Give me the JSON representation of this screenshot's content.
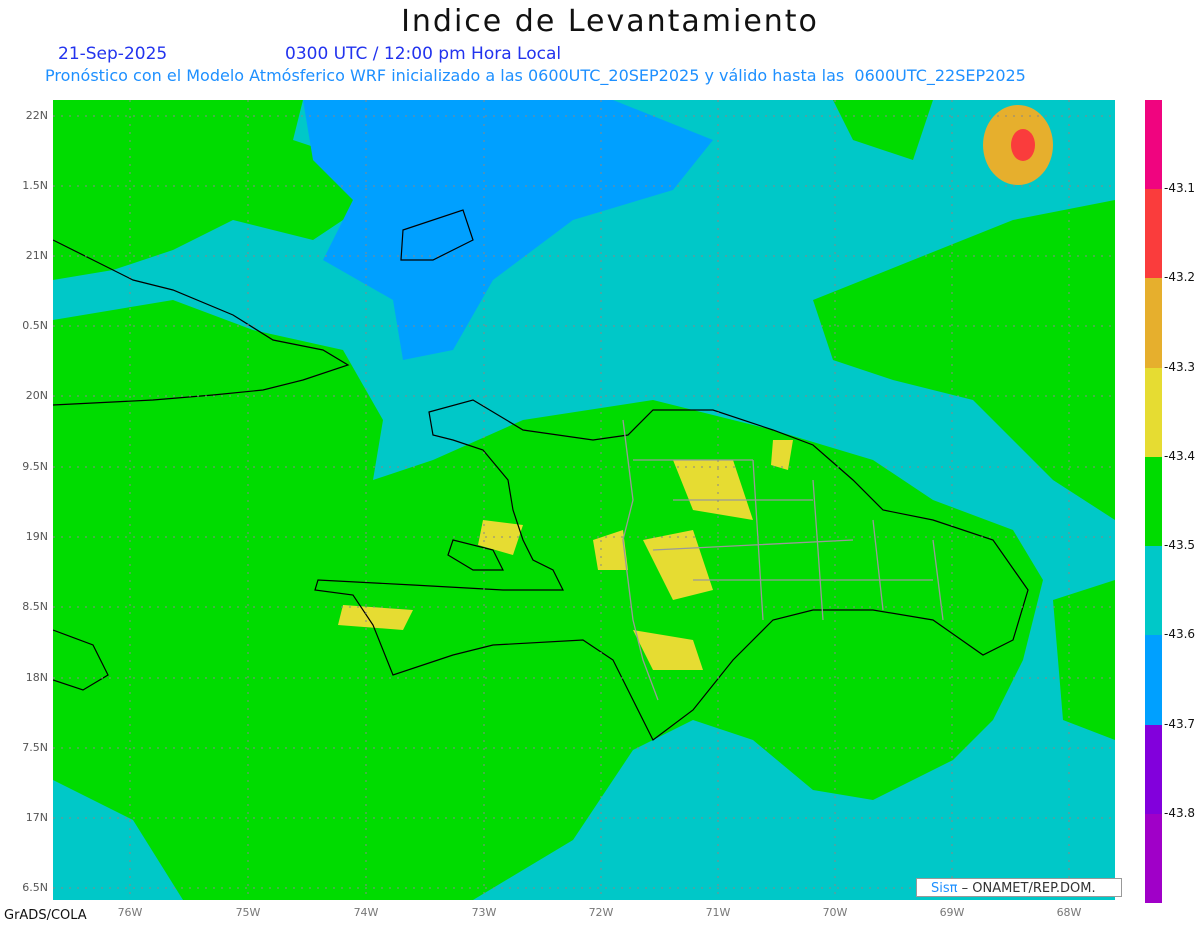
{
  "title": "Indice de Levantamiento",
  "date": "21-Sep-2025",
  "time": "0300 UTC / 12:00 pm Hora Local",
  "subtitle": "Pronóstico con el Modelo Atmósferico WRF inicializado a las 0600UTC_20SEP2025 y válido hasta las  0600UTC_22SEP2025",
  "lat_labels": [
    "22N",
    "1.5N",
    "21N",
    "0.5N",
    "20N",
    "9.5N",
    "19N",
    "8.5N",
    "18N",
    "7.5N",
    "17N",
    "6.5N"
  ],
  "lon_labels": [
    "76W",
    "75W",
    "74W",
    "73W",
    "72W",
    "71W",
    "70W",
    "69W",
    "68W"
  ],
  "colorbar": {
    "colors": [
      "#f0047f",
      "#fa3c3c",
      "#e6af2d",
      "#e6dc32",
      "#00dc00",
      "#00c8c8",
      "#00a0ff",
      "#8200dc",
      "#a000c8"
    ],
    "labels": [
      "-43.1",
      "-43.2",
      "-43.3",
      "-43.4",
      "-43.5",
      "-43.6",
      "-43.7",
      "-43.8"
    ]
  },
  "logo": {
    "brand": "Sisπ",
    "text": " –  ONAMET/REP.DOM."
  },
  "footer": "GrADS/COLA"
}
